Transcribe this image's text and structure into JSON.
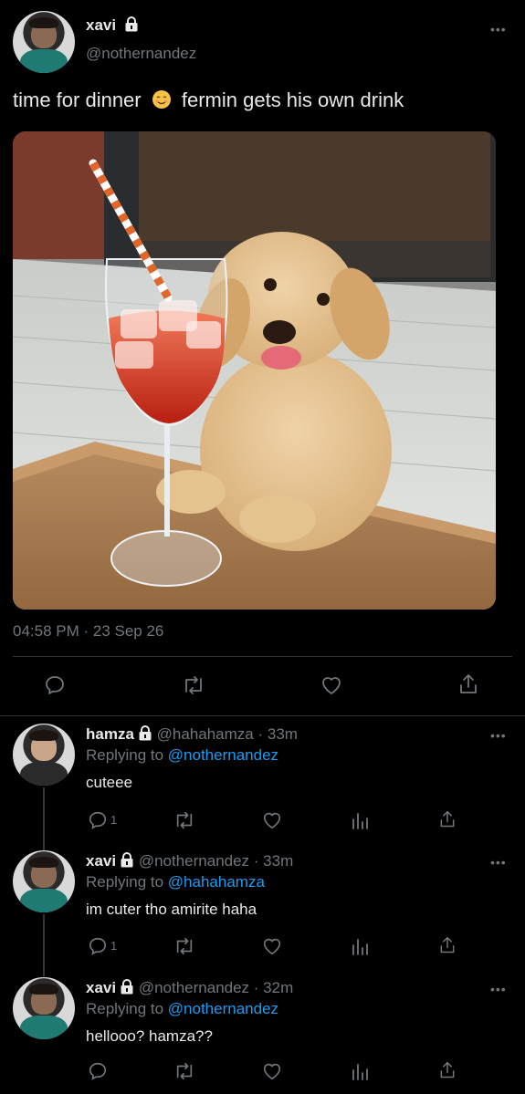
{
  "main_tweet": {
    "display_name": "xavi",
    "handle": "@nothernandez",
    "text_before_emoji": "time for dinner",
    "text_after_emoji": "fermin gets his own drink",
    "timestamp": "04:58 PM · 23 Sep 26"
  },
  "replies": [
    {
      "display_name": "hamza",
      "handle": "@hahahamza",
      "time": "· 33m",
      "replying_prefix": "Replying to",
      "replying_to": "@nothernandez",
      "text": "cuteee",
      "reply_count": "1"
    },
    {
      "display_name": "xavi",
      "handle": "@nothernandez",
      "time": "· 33m",
      "replying_prefix": "Replying to",
      "replying_to": "@hahahamza",
      "text": "im cuter tho amirite haha",
      "reply_count": "1"
    },
    {
      "display_name": "xavi",
      "handle": "@nothernandez",
      "time": "· 32m",
      "replying_prefix": "Replying to",
      "replying_to": "@nothernandez",
      "text": "hellooo? hamza??",
      "reply_count": ""
    }
  ],
  "colors": {
    "background": "#000000",
    "text": "#e7e9ea",
    "muted": "#71767b",
    "link": "#1d9bf0"
  },
  "icons": [
    "reply-icon",
    "retweet-icon",
    "like-icon",
    "share-icon",
    "analytics-icon",
    "lock-icon",
    "more-icon"
  ]
}
